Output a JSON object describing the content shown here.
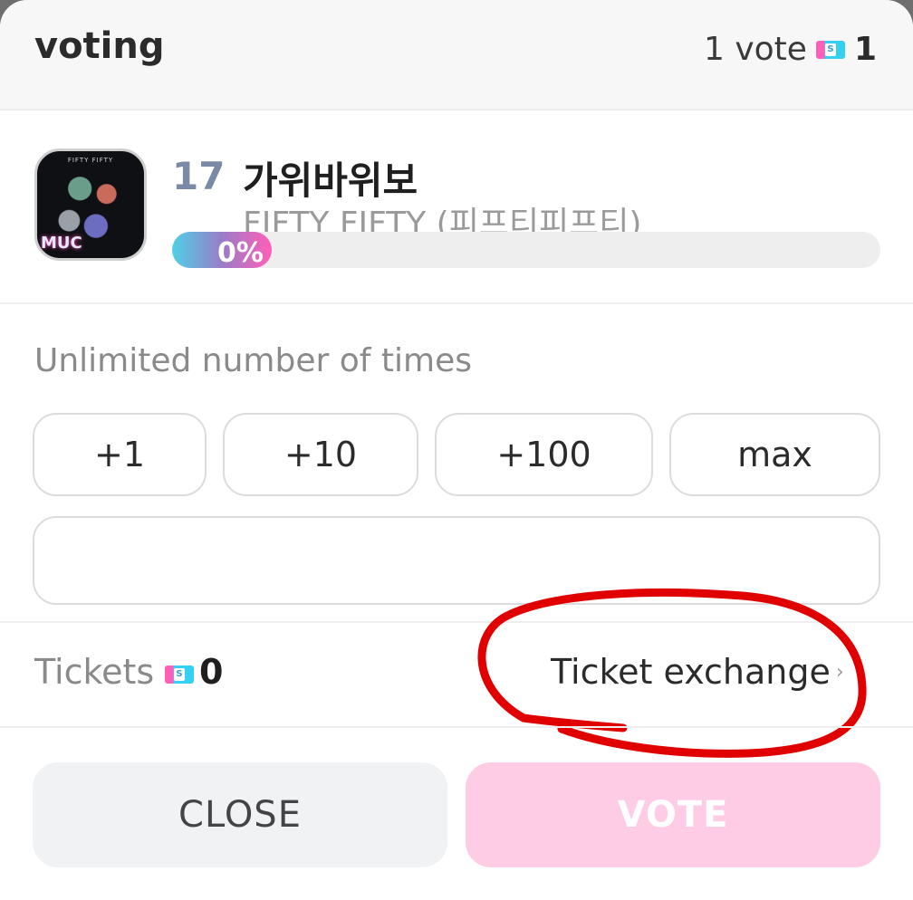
{
  "header": {
    "title": "voting",
    "vote_label": "1 vote",
    "vote_count": "1"
  },
  "item": {
    "rank": "17",
    "song": "가위바위보",
    "artist": "FIFTY FIFTY (피프티피프티)",
    "progress_percent": 0,
    "progress_label": "0%",
    "album_top_text": "FIFTY FIFTY",
    "album_bottom_text": "MUC"
  },
  "vote_options": {
    "limit_text": "Unlimited number of times",
    "buttons": [
      "+1",
      "+10",
      "+100",
      "max"
    ],
    "input_value": ""
  },
  "tickets": {
    "label": "Tickets",
    "count": "0",
    "exchange_label": "Ticket exchange"
  },
  "footer": {
    "close_label": "CLOSE",
    "vote_label": "VOTE"
  },
  "colors": {
    "vote_pink_disabled": "#ffcce6",
    "rank_color": "#7a8aa6",
    "annotation_red": "#e00000"
  },
  "icons": [
    "ticket-icon",
    "chevron-right-icon"
  ]
}
